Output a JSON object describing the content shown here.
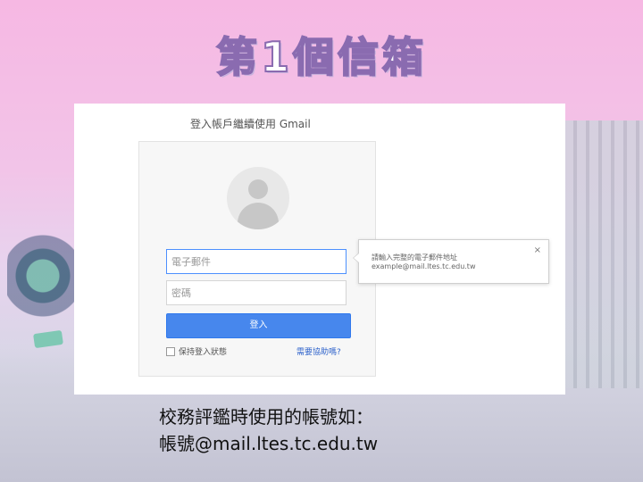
{
  "slide": {
    "title": "第1個信箱",
    "caption_line1": "校務評鑑時使用的帳號如：",
    "caption_line2": "帳號@mail.ltes.tc.edu.tw"
  },
  "gmail_login": {
    "heading": "登入帳戶繼續使用 Gmail",
    "email_placeholder": "電子郵件",
    "password_placeholder": "密碼",
    "signin_button": "登入",
    "remember_label": "保持登入狀態",
    "help_link": "需要協助嗎?",
    "tooltip_line1": "請輸入完整的電子郵件地址",
    "tooltip_line2": "example@mail.ltes.tc.edu.tw",
    "tooltip_close": "×"
  },
  "colors": {
    "signin_button": "#4787ed",
    "title_outline": "#8a6bb0",
    "link": "#3366cc"
  },
  "icons": {
    "avatar": "user-silhouette-icon",
    "close": "close-icon"
  }
}
